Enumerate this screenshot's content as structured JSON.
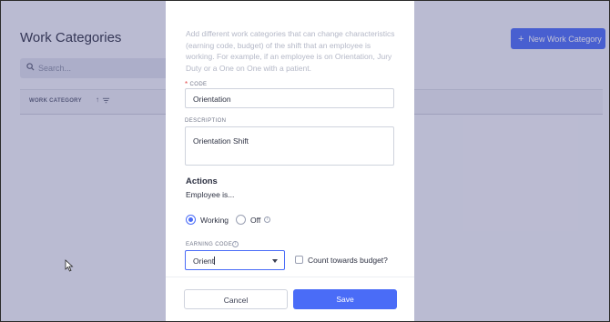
{
  "background": {
    "page_title": "Work Categories",
    "search_placeholder": "Search...",
    "table_header": {
      "column": "WORK CATEGORY",
      "sort_indicator": "↑"
    },
    "new_button_label": "New Work Category",
    "new_button_icon": "plus-icon"
  },
  "modal": {
    "description": "Add different work categories that can change characteristics (earning code, budget) of the shift that an employee is working. For example, if an employee is on Orientation, Jury Duty or a One on One with a patient.",
    "code": {
      "required_mark": "*",
      "label": "CODE",
      "value": "Orientation"
    },
    "description_field": {
      "label": "DESCRIPTION",
      "value": "Orientation Shift"
    },
    "actions": {
      "title": "Actions",
      "employee_is_label": "Employee is...",
      "options": [
        {
          "label": "Working",
          "selected": true
        },
        {
          "label": "Off",
          "selected": false
        }
      ]
    },
    "earning_code": {
      "label": "EARNING CODE",
      "value": "Orient",
      "info_icon": "info-icon"
    },
    "count_budget": {
      "label": "Count towards budget?",
      "checked": false
    },
    "buttons": {
      "cancel": "Cancel",
      "save": "Save"
    }
  },
  "colors": {
    "accent": "#4a6cf7",
    "overlay": "rgba(70,70,130,0.33)",
    "required": "#e04848"
  }
}
